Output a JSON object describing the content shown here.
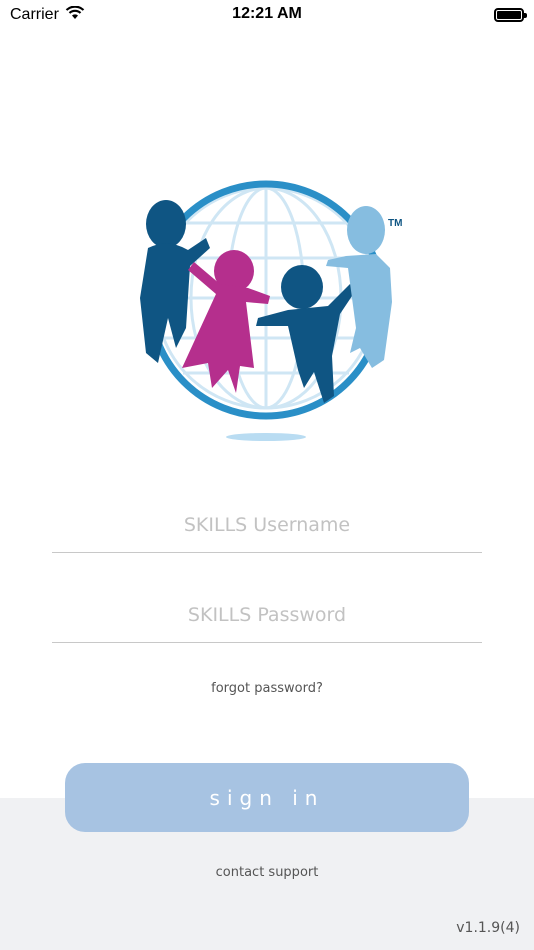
{
  "status_bar": {
    "carrier": "Carrier",
    "time": "12:21 AM",
    "battery_level": 1.0
  },
  "logo": {
    "trademark": "TM",
    "colors": {
      "globe": "#2a8fc7",
      "globe_grid": "#cfe6f4",
      "figure_dark": "#0f5583",
      "figure_pink": "#b52f8d",
      "figure_light": "#86bde0",
      "shadow": "#b9dcf2"
    }
  },
  "form": {
    "username_placeholder": "SKILLS Username",
    "password_placeholder": "SKILLS Password",
    "forgot_password": "forgot password?",
    "sign_in": "sign in",
    "contact_support": "contact support"
  },
  "version": "v1.1.9(4)",
  "colors": {
    "button": "#a7c3e2",
    "bottom_panel": "#f0f1f3"
  }
}
